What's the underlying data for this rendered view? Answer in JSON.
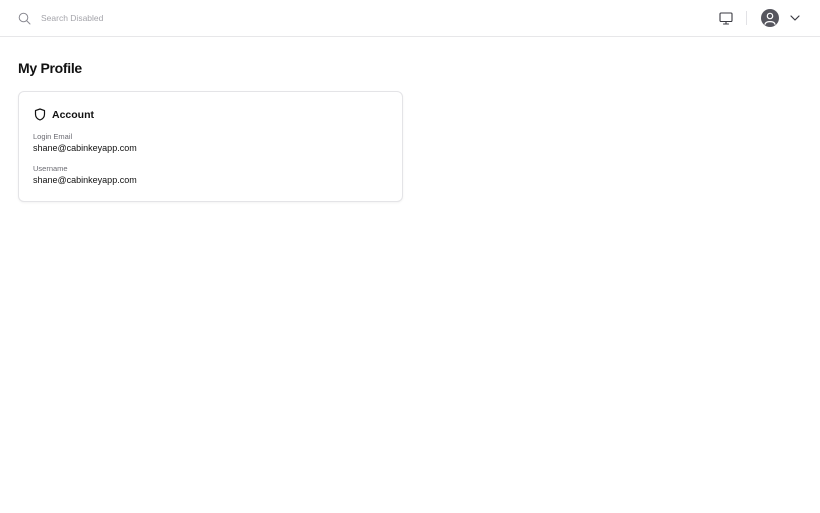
{
  "header": {
    "search": {
      "placeholder": "Search Disabled",
      "value": ""
    },
    "icons": {
      "search": "search-icon",
      "display": "monitor-icon",
      "avatar": "user-avatar-icon",
      "menu": "chevron-down-icon"
    }
  },
  "page": {
    "title": "My Profile"
  },
  "account": {
    "title": "Account",
    "icon": "shield-icon",
    "fields": [
      {
        "label": "Login Email",
        "value": "shane@cabinkeyapp.com"
      },
      {
        "label": "Username",
        "value": "shane@cabinkeyapp.com"
      }
    ]
  },
  "colors": {
    "text": "#111111",
    "muted": "#6b6b72",
    "border": "#e4e4e7",
    "avatar_bg": "#56565e"
  }
}
